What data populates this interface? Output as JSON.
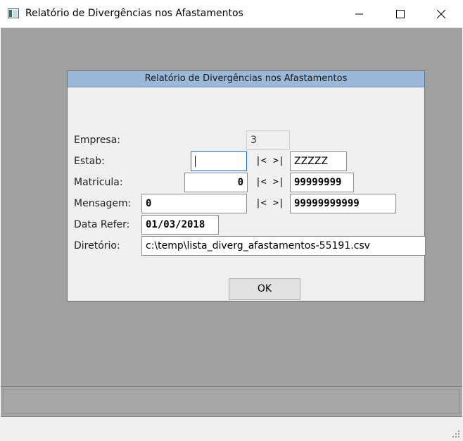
{
  "window": {
    "title": "Relatório de Divergências nos Afastamentos",
    "controls": [
      "minimize",
      "maximize",
      "close"
    ]
  },
  "dialog": {
    "title": "Relatório de Divergências nos Afastamentos",
    "labels": {
      "empresa": "Empresa:",
      "estab": "Estab:",
      "matricula": "Matricula:",
      "mensagem": "Mensagem:",
      "data_refer": "Data Refer:",
      "diretorio": "Diretório:"
    },
    "values": {
      "empresa": "3",
      "estab_from": "",
      "estab_to": "ZZZZZ",
      "matricula_from": "0",
      "matricula_to": "99999999",
      "mensagem_from": "0",
      "mensagem_to": "99999999999",
      "data_refer": "01/03/2018",
      "diretorio": "c:\\temp\\lista_diverg_afastamentos-55191.csv"
    },
    "range_first": "|<",
    "range_last": ">|",
    "ok_label": "OK"
  },
  "colors": {
    "desktop": "#a0a0a0",
    "dialog_title_bg": "#9cb8d8",
    "focus_border": "#1c6fd6"
  },
  "icons": [
    "app-icon",
    "minimize-icon",
    "maximize-icon",
    "close-icon",
    "size-grip-icon"
  ]
}
